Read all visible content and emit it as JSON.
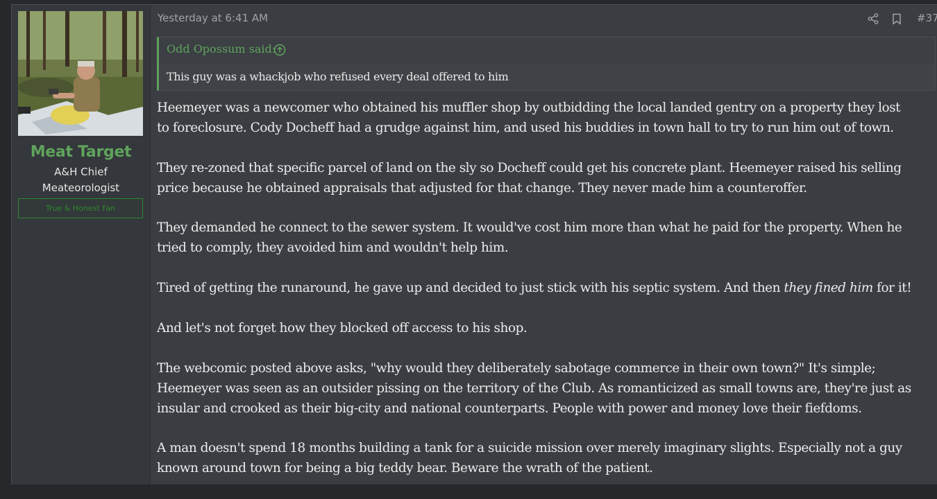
{
  "post": {
    "timestamp": "Yesterday at 6:41 AM",
    "post_number": "#37",
    "icons": {
      "share": "share-icon",
      "bookmark": "bookmark-icon",
      "quote_jump": "arrow-up-circle-icon"
    }
  },
  "user": {
    "name": "Meat Target",
    "title_line1": "A&H Chief",
    "title_line2": "Meateorologist",
    "banner": "True & Honest Fan",
    "name_color": "#5fa35c",
    "banner_color": "#2d8a2d"
  },
  "quote": {
    "author": "Odd Opossum said:",
    "text": "This guy was a whackjob who refused every deal offered to him"
  },
  "body": {
    "p1": [
      "Heemeyer was a newcomer who obtained his muffler shop by outbidding the local landed gentry on a property they lost",
      "to foreclosure. Cody Docheff had a grudge against him, and used his buddies in town hall to try to run him out of town."
    ],
    "p2": [
      "They re-zoned that specific parcel of land on the sly so Docheff could get his concrete plant. Heemeyer raised his selling",
      "price because he obtained appraisals that adjusted for that change. They never made him a counteroffer."
    ],
    "p3": [
      "They demanded he connect to the sewer system. It would've cost him more than what he paid for the property. When he",
      "tried to comply, they avoided him and wouldn't help him."
    ],
    "p4": {
      "before": "Tired of getting the runaround, he gave up and decided to just stick with his septic system. And then ",
      "emphasis": "they fined him",
      "after": " for it!"
    },
    "p5": "And let's not forget how they blocked off access to his shop.",
    "p6": [
      "The webcomic posted above asks, \"why would they deliberately sabotage commerce in their own town?\" It's simple;",
      "Heemeyer was seen as an outsider pissing on the territory of the Club. As romanticized as small towns are, they're just as",
      "insular and crooked as their big-city and national counterparts. People with power and money love their fiefdoms."
    ],
    "p7": [
      "A man doesn't spend 18 months building a tank for a suicide mission over merely imaginary slights. Especially not a guy",
      "known around town for being a big teddy bear. Beware the wrath of the patient."
    ]
  }
}
